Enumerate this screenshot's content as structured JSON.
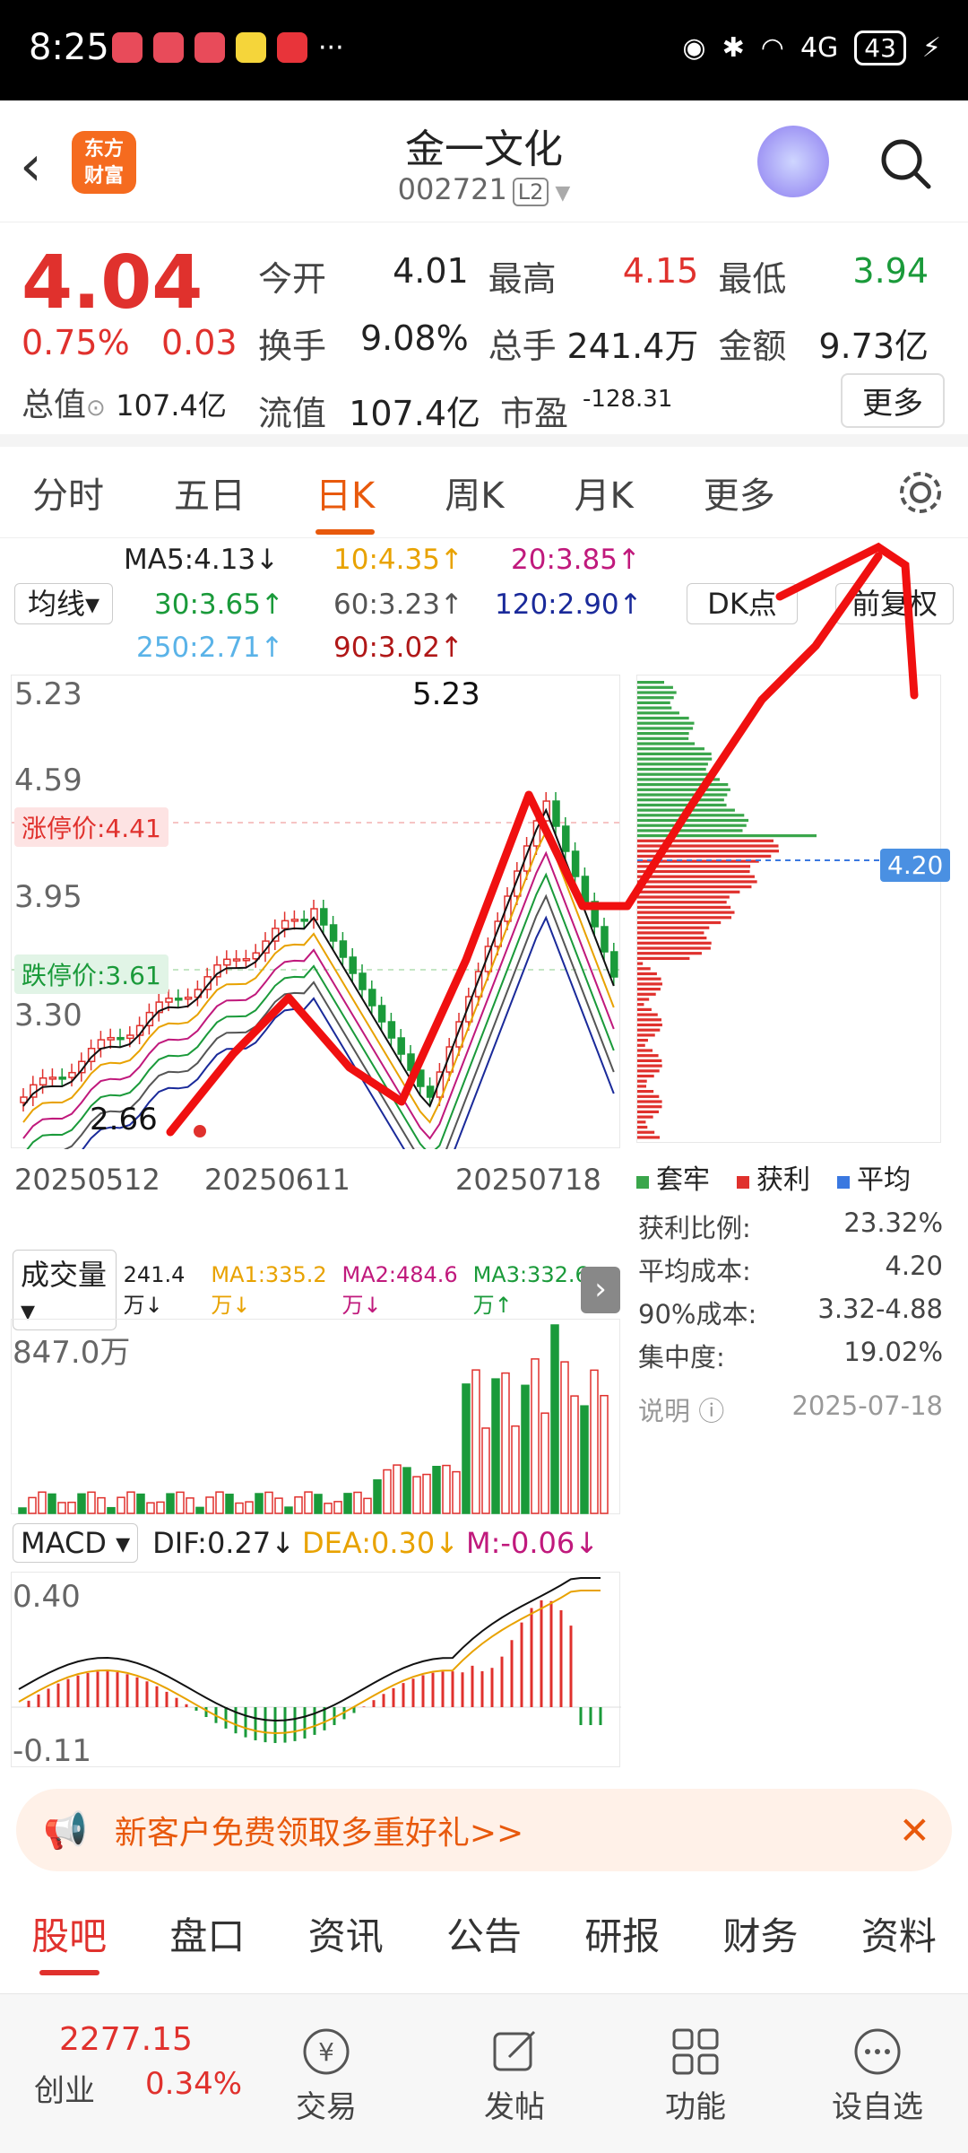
{
  "status": {
    "time": "8:25",
    "battery": "43",
    "network": "4G"
  },
  "header": {
    "title": "金一文化",
    "code": "002721",
    "level": "L2",
    "logo": "东方\n财富"
  },
  "quote": {
    "price": "4.04",
    "change_pct": "0.75%",
    "change": "0.03",
    "total_label": "总值",
    "total_value": "107.4亿",
    "rows": [
      [
        {
          "k": "今开",
          "v": "4.01",
          "c": "#222"
        },
        {
          "k": "最高",
          "v": "4.15",
          "c": "#e0312d"
        },
        {
          "k": "最低",
          "v": "3.94",
          "c": "#1a9a3a"
        }
      ],
      [
        {
          "k": "换手",
          "v": "9.08%",
          "c": "#222"
        },
        {
          "k": "总手",
          "v": "241.4万",
          "c": "#222"
        },
        {
          "k": "金额",
          "v": "9.73亿",
          "c": "#222"
        }
      ],
      [
        {
          "k": "流值",
          "v": "107.4亿",
          "c": "#222"
        },
        {
          "k": "市盈",
          "v": "-128.31",
          "c": "#222"
        }
      ]
    ],
    "more": "更多"
  },
  "tabs": [
    "分时",
    "五日",
    "日K",
    "周K",
    "月K",
    "更多"
  ],
  "active_tab": "日K",
  "ma": {
    "ma5": "MA5:4.13↓",
    "ma10": "10:4.35↑",
    "ma20": "20:3.85↑",
    "ma30": "30:3.65↑",
    "ma60": "60:3.23↑",
    "ma120": "120:2.90↑",
    "ma250": "250:2.71↑",
    "ma90": "90:3.02↑"
  },
  "controls": {
    "junxian": "均线",
    "dk": "DK点",
    "fq": "前复权"
  },
  "kchart": {
    "y_labels": [
      "5.23",
      "4.59",
      "3.95",
      "3.30"
    ],
    "top_label": "5.23",
    "low_label": "2.66",
    "limit_up": "涨停价:4.41",
    "limit_down": "跌停价:3.61",
    "dates": [
      "20250512",
      "20250611",
      "20250718"
    ],
    "cost_price": "4.20"
  },
  "chip": {
    "legend": [
      "套牢",
      "获利",
      "平均"
    ],
    "stats": [
      {
        "k": "获利比例:",
        "v": "23.32%"
      },
      {
        "k": "平均成本:",
        "v": "4.20"
      },
      {
        "k": "90%成本:",
        "v": "3.32-4.88"
      },
      {
        "k": "集中度:",
        "v": "19.02%"
      }
    ],
    "note": "说明",
    "date": "2025-07-18"
  },
  "volume": {
    "selector": "成交量",
    "value": "241.4万↓",
    "ma1": "MA1:335.2万↓",
    "ma2": "MA2:484.6万↓",
    "ma3": "MA3:332.6万↑",
    "max_label": "847.0万"
  },
  "macd": {
    "selector": "MACD",
    "dif": "DIF:0.27↓",
    "dea": "DEA:0.30↓",
    "m": "M:-0.06↓",
    "max_label": "0.40",
    "min_label": "-0.11"
  },
  "promo": {
    "text": "新客户免费领取多重好礼>>"
  },
  "bottom_tabs": [
    "股吧",
    "盘口",
    "资讯",
    "公告",
    "研报",
    "财务",
    "资料"
  ],
  "nav": {
    "index_value": "2277.15",
    "index_name": "创业",
    "index_change": "0.34%",
    "items": [
      "交易",
      "发帖",
      "功能",
      "设自选"
    ]
  },
  "colors": {
    "up": "#e0312d",
    "down": "#1a9a3a",
    "accent": "#e8590c"
  }
}
